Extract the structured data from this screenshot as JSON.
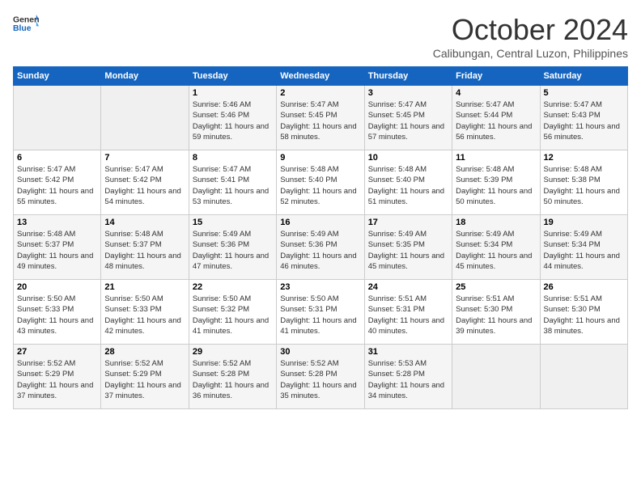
{
  "header": {
    "logo_general": "General",
    "logo_blue": "Blue",
    "month_title": "October 2024",
    "location": "Calibungan, Central Luzon, Philippines"
  },
  "days_of_week": [
    "Sunday",
    "Monday",
    "Tuesday",
    "Wednesday",
    "Thursday",
    "Friday",
    "Saturday"
  ],
  "weeks": [
    [
      {
        "day": "",
        "info": ""
      },
      {
        "day": "",
        "info": ""
      },
      {
        "day": "1",
        "info": "Sunrise: 5:46 AM\nSunset: 5:46 PM\nDaylight: 11 hours and 59 minutes."
      },
      {
        "day": "2",
        "info": "Sunrise: 5:47 AM\nSunset: 5:45 PM\nDaylight: 11 hours and 58 minutes."
      },
      {
        "day": "3",
        "info": "Sunrise: 5:47 AM\nSunset: 5:45 PM\nDaylight: 11 hours and 57 minutes."
      },
      {
        "day": "4",
        "info": "Sunrise: 5:47 AM\nSunset: 5:44 PM\nDaylight: 11 hours and 56 minutes."
      },
      {
        "day": "5",
        "info": "Sunrise: 5:47 AM\nSunset: 5:43 PM\nDaylight: 11 hours and 56 minutes."
      }
    ],
    [
      {
        "day": "6",
        "info": "Sunrise: 5:47 AM\nSunset: 5:42 PM\nDaylight: 11 hours and 55 minutes."
      },
      {
        "day": "7",
        "info": "Sunrise: 5:47 AM\nSunset: 5:42 PM\nDaylight: 11 hours and 54 minutes."
      },
      {
        "day": "8",
        "info": "Sunrise: 5:47 AM\nSunset: 5:41 PM\nDaylight: 11 hours and 53 minutes."
      },
      {
        "day": "9",
        "info": "Sunrise: 5:48 AM\nSunset: 5:40 PM\nDaylight: 11 hours and 52 minutes."
      },
      {
        "day": "10",
        "info": "Sunrise: 5:48 AM\nSunset: 5:40 PM\nDaylight: 11 hours and 51 minutes."
      },
      {
        "day": "11",
        "info": "Sunrise: 5:48 AM\nSunset: 5:39 PM\nDaylight: 11 hours and 50 minutes."
      },
      {
        "day": "12",
        "info": "Sunrise: 5:48 AM\nSunset: 5:38 PM\nDaylight: 11 hours and 50 minutes."
      }
    ],
    [
      {
        "day": "13",
        "info": "Sunrise: 5:48 AM\nSunset: 5:37 PM\nDaylight: 11 hours and 49 minutes."
      },
      {
        "day": "14",
        "info": "Sunrise: 5:48 AM\nSunset: 5:37 PM\nDaylight: 11 hours and 48 minutes."
      },
      {
        "day": "15",
        "info": "Sunrise: 5:49 AM\nSunset: 5:36 PM\nDaylight: 11 hours and 47 minutes."
      },
      {
        "day": "16",
        "info": "Sunrise: 5:49 AM\nSunset: 5:36 PM\nDaylight: 11 hours and 46 minutes."
      },
      {
        "day": "17",
        "info": "Sunrise: 5:49 AM\nSunset: 5:35 PM\nDaylight: 11 hours and 45 minutes."
      },
      {
        "day": "18",
        "info": "Sunrise: 5:49 AM\nSunset: 5:34 PM\nDaylight: 11 hours and 45 minutes."
      },
      {
        "day": "19",
        "info": "Sunrise: 5:49 AM\nSunset: 5:34 PM\nDaylight: 11 hours and 44 minutes."
      }
    ],
    [
      {
        "day": "20",
        "info": "Sunrise: 5:50 AM\nSunset: 5:33 PM\nDaylight: 11 hours and 43 minutes."
      },
      {
        "day": "21",
        "info": "Sunrise: 5:50 AM\nSunset: 5:33 PM\nDaylight: 11 hours and 42 minutes."
      },
      {
        "day": "22",
        "info": "Sunrise: 5:50 AM\nSunset: 5:32 PM\nDaylight: 11 hours and 41 minutes."
      },
      {
        "day": "23",
        "info": "Sunrise: 5:50 AM\nSunset: 5:31 PM\nDaylight: 11 hours and 41 minutes."
      },
      {
        "day": "24",
        "info": "Sunrise: 5:51 AM\nSunset: 5:31 PM\nDaylight: 11 hours and 40 minutes."
      },
      {
        "day": "25",
        "info": "Sunrise: 5:51 AM\nSunset: 5:30 PM\nDaylight: 11 hours and 39 minutes."
      },
      {
        "day": "26",
        "info": "Sunrise: 5:51 AM\nSunset: 5:30 PM\nDaylight: 11 hours and 38 minutes."
      }
    ],
    [
      {
        "day": "27",
        "info": "Sunrise: 5:52 AM\nSunset: 5:29 PM\nDaylight: 11 hours and 37 minutes."
      },
      {
        "day": "28",
        "info": "Sunrise: 5:52 AM\nSunset: 5:29 PM\nDaylight: 11 hours and 37 minutes."
      },
      {
        "day": "29",
        "info": "Sunrise: 5:52 AM\nSunset: 5:28 PM\nDaylight: 11 hours and 36 minutes."
      },
      {
        "day": "30",
        "info": "Sunrise: 5:52 AM\nSunset: 5:28 PM\nDaylight: 11 hours and 35 minutes."
      },
      {
        "day": "31",
        "info": "Sunrise: 5:53 AM\nSunset: 5:28 PM\nDaylight: 11 hours and 34 minutes."
      },
      {
        "day": "",
        "info": ""
      },
      {
        "day": "",
        "info": ""
      }
    ]
  ]
}
